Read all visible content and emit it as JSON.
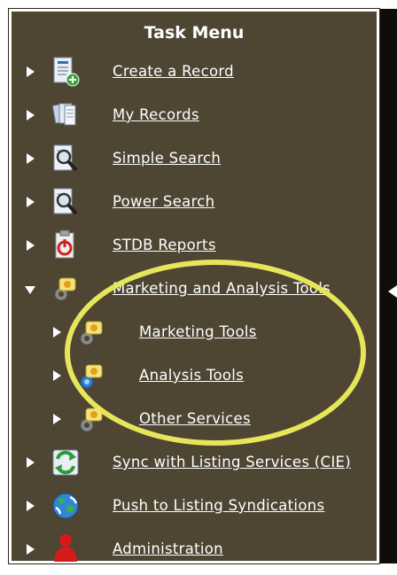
{
  "menu": {
    "title": "Task Menu",
    "items": [
      {
        "label": "Create a Record",
        "icon": "create-record-icon",
        "expanded": false,
        "indent": 0
      },
      {
        "label": "My Records",
        "icon": "my-records-icon",
        "expanded": false,
        "indent": 0
      },
      {
        "label": "Simple Search",
        "icon": "simple-search-icon",
        "expanded": false,
        "indent": 0
      },
      {
        "label": "Power Search",
        "icon": "power-search-icon",
        "expanded": false,
        "indent": 0
      },
      {
        "label": "STDB Reports",
        "icon": "stdb-reports-icon",
        "expanded": false,
        "indent": 0
      },
      {
        "label": "Marketing and Analysis Tools",
        "icon": "marketing-analysis-icon",
        "expanded": true,
        "indent": 0
      },
      {
        "label": "Marketing Tools",
        "icon": "marketing-tools-icon",
        "expanded": false,
        "indent": 1
      },
      {
        "label": "Analysis Tools",
        "icon": "analysis-tools-icon",
        "expanded": false,
        "indent": 1
      },
      {
        "label": "Other Services",
        "icon": "other-services-icon",
        "expanded": false,
        "indent": 1
      },
      {
        "label": "Sync with Listing Services (CIE)",
        "icon": "sync-icon",
        "expanded": false,
        "indent": 0
      },
      {
        "label": "Push to Listing Syndications",
        "icon": "globe-icon",
        "expanded": false,
        "indent": 0
      },
      {
        "label": "Administration",
        "icon": "administration-icon",
        "expanded": false,
        "indent": 0
      }
    ]
  },
  "colors": {
    "panel_background": "#4e4533",
    "highlight_ellipse": "#e6e65a",
    "text": "#ffffff"
  }
}
